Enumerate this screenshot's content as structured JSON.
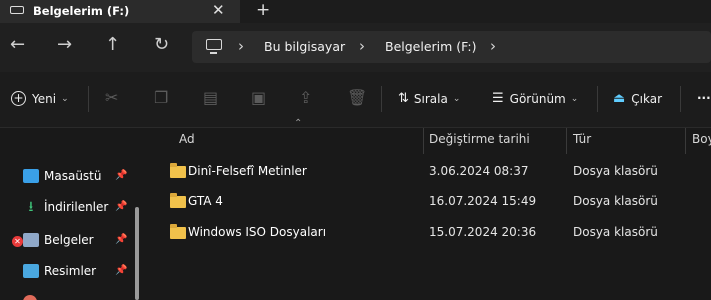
{
  "tab": {
    "title": "Belgelerim (F:)",
    "close": "✕",
    "new": "+"
  },
  "nav": {
    "back": "←",
    "forward": "→",
    "up": "↑",
    "refresh": "↻"
  },
  "address": {
    "crumbs": [
      "Bu bilgisayar",
      "Belgelerim (F:)"
    ],
    "separator": "›"
  },
  "commands": {
    "new": "Yeni",
    "sort": "Sırala",
    "view": "Görünüm",
    "eject": "Çıkar",
    "more": "···"
  },
  "sidebar": {
    "items": [
      {
        "label": "Masaüstü",
        "pin": "📌"
      },
      {
        "label": "İndirilenler",
        "pin": "📌"
      },
      {
        "label": "Belgeler",
        "pin": "📌"
      },
      {
        "label": "Resimler",
        "pin": "📌"
      }
    ],
    "error_badge": "✕"
  },
  "columns": {
    "name": "Ad",
    "modified": "Değiştirme tarihi",
    "type": "Tür",
    "size": "Boy"
  },
  "rows": [
    {
      "name": "Dinî-Felsefî Metinler",
      "modified": "3.06.2024 08:37",
      "type": "Dosya klasörü"
    },
    {
      "name": "GTA 4",
      "modified": "16.07.2024 15:49",
      "type": "Dosya klasörü"
    },
    {
      "name": "Windows ISO Dosyaları",
      "modified": "15.07.2024 20:36",
      "type": "Dosya klasörü"
    }
  ],
  "colors": {
    "folder": "#f0c14b",
    "accent": "#60cdff",
    "error": "#e83a3a"
  }
}
